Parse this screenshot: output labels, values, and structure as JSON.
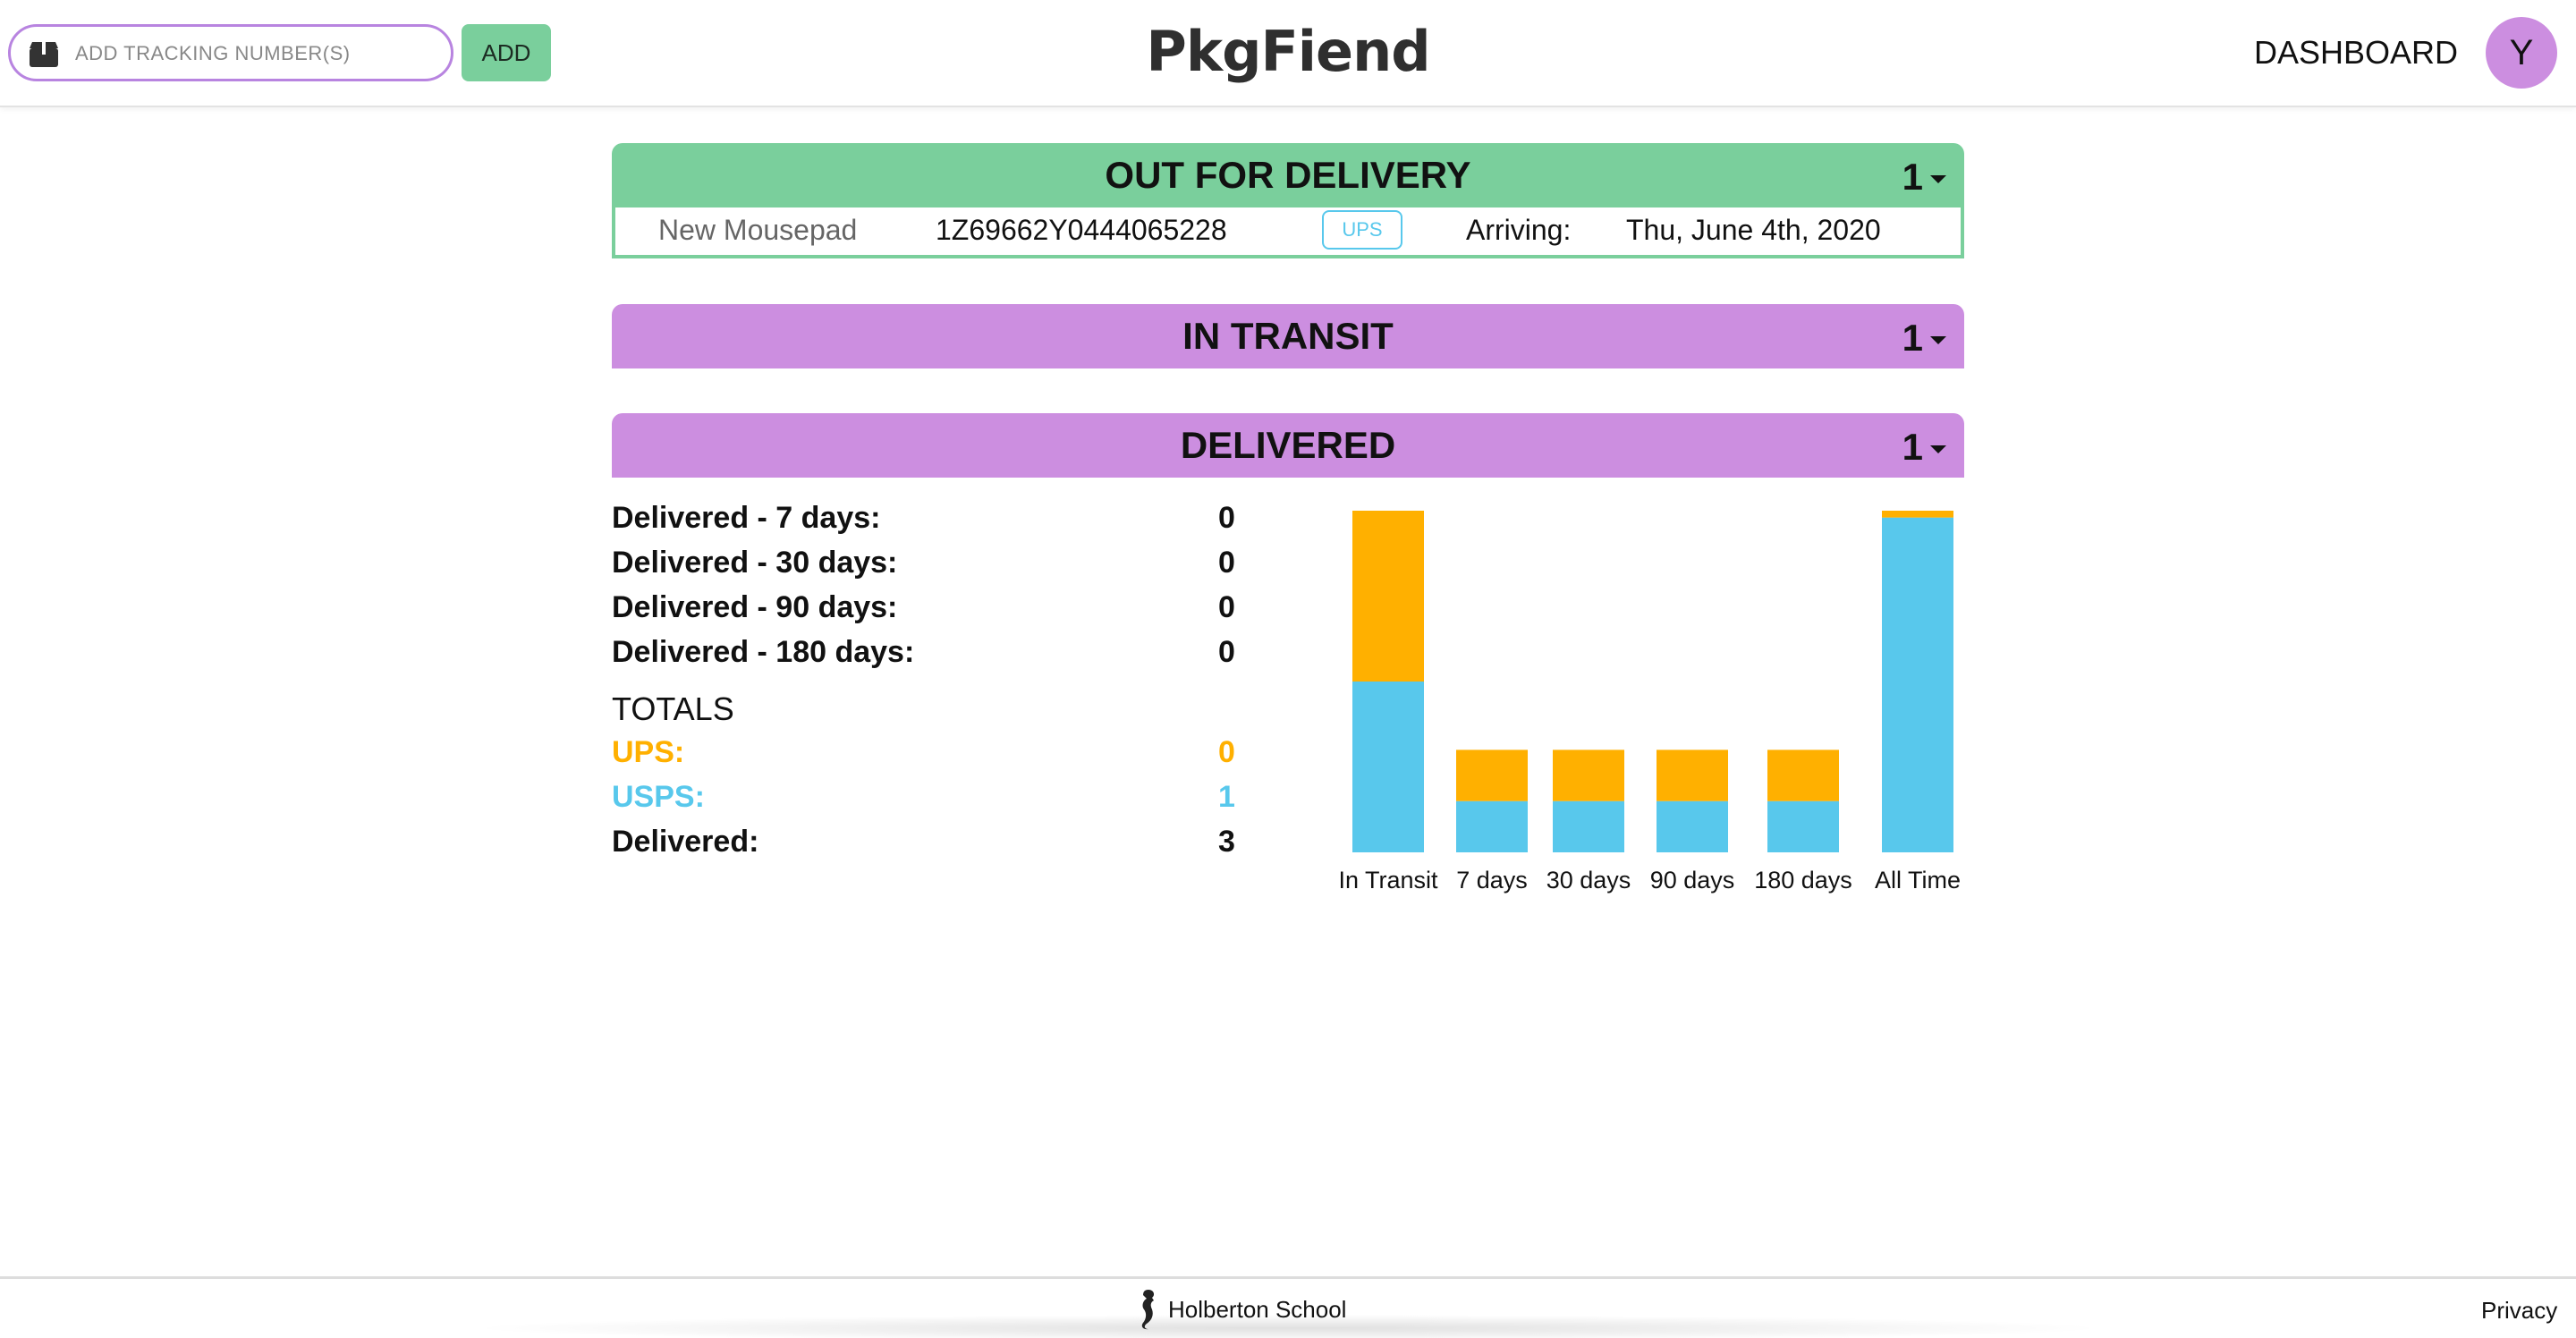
{
  "header": {
    "tracking_placeholder": "ADD TRACKING NUMBER(S)",
    "add_label": "ADD",
    "logo": "PkgFiend",
    "dashboard_label": "DASHBOARD",
    "avatar_initial": "Y"
  },
  "sections": {
    "out_for_delivery": {
      "title": "OUT FOR DELIVERY",
      "count": "1"
    },
    "in_transit": {
      "title": "IN TRANSIT",
      "count": "1"
    },
    "delivered": {
      "title": "DELIVERED",
      "count": "1"
    }
  },
  "package": {
    "name": "New Mousepad",
    "tracking": "1Z69662Y0444065228",
    "carrier": "UPS",
    "arriving_label": "Arriving:",
    "date": "Thu, June 4th, 2020"
  },
  "stats": {
    "rows": [
      {
        "label": "Delivered - 7 days:",
        "value": "0"
      },
      {
        "label": "Delivered - 30 days:",
        "value": "0"
      },
      {
        "label": "Delivered - 90 days:",
        "value": "0"
      },
      {
        "label": "Delivered - 180 days:",
        "value": "0"
      }
    ],
    "totals_label": "TOTALS",
    "ups_label": "UPS:",
    "ups_value": "0",
    "usps_label": "USPS:",
    "usps_value": "1",
    "delivered_label": "Delivered:",
    "delivered_value": "3"
  },
  "colors": {
    "green": "#7acf9c",
    "purple": "#cc8ee0",
    "ups": "#ffb000",
    "usps": "#58c8ec"
  },
  "chart_data": {
    "type": "bar",
    "stacked": true,
    "categories": [
      "In Transit",
      "7 days",
      "30 days",
      "90 days",
      "180 days",
      "All Time"
    ],
    "series": [
      {
        "color": "#58c8ec",
        "values": [
          0.5,
          0.15,
          0.15,
          0.15,
          0.15,
          0.98
        ]
      },
      {
        "color": "#ffb000",
        "values": [
          0.5,
          0.15,
          0.15,
          0.15,
          0.15,
          0.02
        ]
      }
    ],
    "ylim": [
      0,
      1
    ],
    "grid": false
  },
  "footer": {
    "brand": "Holberton School",
    "privacy": "Privacy"
  }
}
